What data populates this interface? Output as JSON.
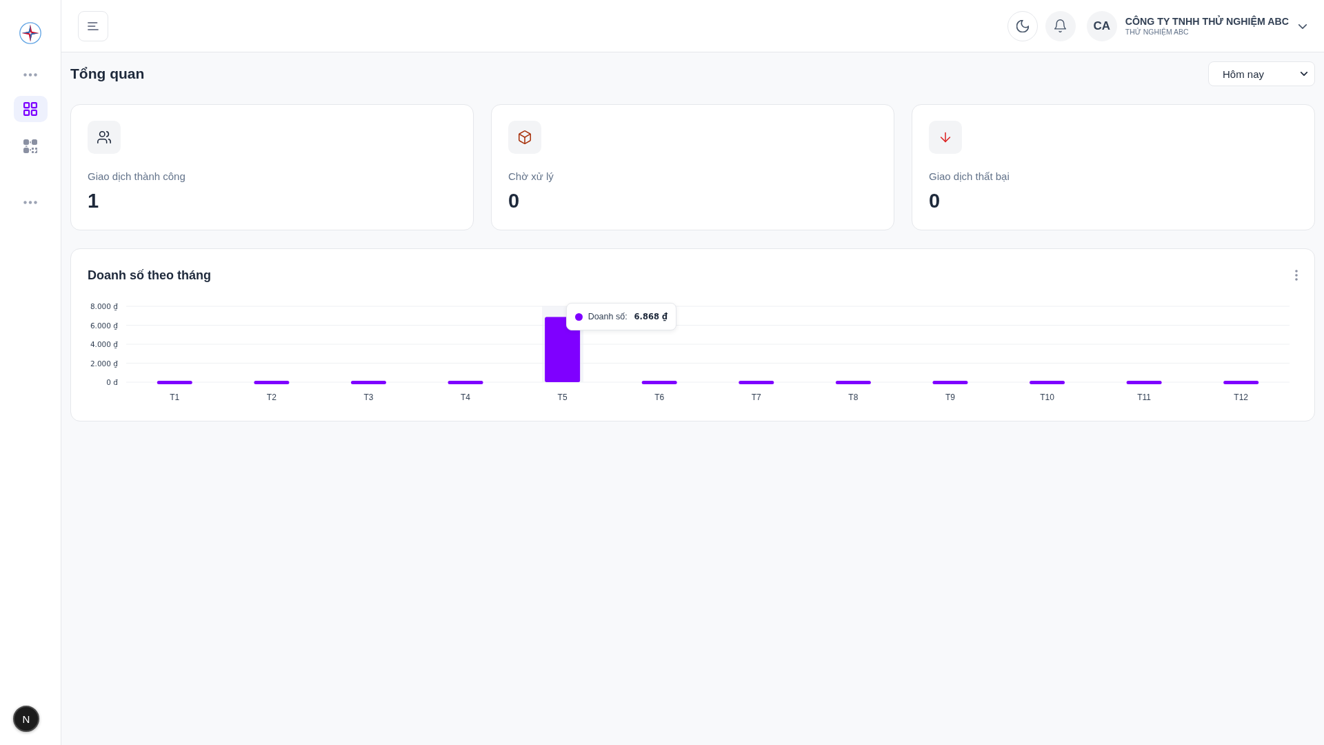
{
  "sidebar": {
    "items": [
      {
        "kind": "group"
      },
      {
        "kind": "link",
        "selected": true
      },
      {
        "kind": "link",
        "selected": false
      },
      {
        "kind": "group"
      }
    ]
  },
  "header": {
    "account": {
      "initials": "CA",
      "company": "CÔNG TY TNHH THỬ NGHIỆM ABC",
      "subtitle": "THỬ NGHIỆM ABC"
    }
  },
  "page": {
    "title": "Tổng quan",
    "period_select": {
      "value": "Hôm nay"
    }
  },
  "stats": [
    {
      "kind": "success",
      "label": "Giao dịch thành công",
      "value": "1"
    },
    {
      "kind": "pending",
      "label": "Chờ xử lý",
      "value": "0"
    },
    {
      "kind": "failed",
      "label": "Giao dịch thất bại",
      "value": "0"
    }
  ],
  "sales_chart": {
    "title": "Doanh số theo tháng",
    "tooltip": {
      "label": "Doanh số:",
      "value": "6.868 ₫"
    },
    "chart_data": {
      "type": "bar",
      "grid": true,
      "categories": [
        "T1",
        "T2",
        "T3",
        "T4",
        "T5",
        "T6",
        "T7",
        "T8",
        "T9",
        "T10",
        "T11",
        "T12"
      ],
      "series": [
        {
          "color": "#7f00ff",
          "values": [
            0,
            0,
            0,
            0,
            6868,
            0,
            0,
            0,
            0,
            0,
            0,
            0
          ]
        }
      ],
      "ylim": [
        0,
        8000
      ],
      "yticks": [
        {
          "value": 0,
          "label": "0 đ"
        },
        {
          "value": 2000,
          "label": "2.000 ₫"
        },
        {
          "value": 4000,
          "label": "4.000 ₫"
        },
        {
          "value": 6000,
          "label": "6.000 ₫"
        },
        {
          "value": 8000,
          "label": "8.000 ₫"
        }
      ]
    }
  },
  "dev_badge": {
    "label": "N"
  }
}
